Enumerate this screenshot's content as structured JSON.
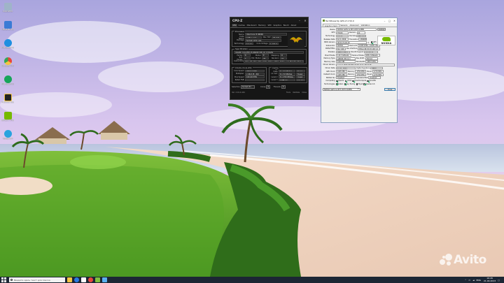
{
  "desktop": {
    "icons": [
      {
        "label": "Корзина",
        "color": "#9fb4c8"
      },
      {
        "label": "Панель управления",
        "color": "#3a7bd5"
      },
      {
        "label": "Microsoft Edge",
        "color": "#1f8fe0"
      },
      {
        "label": "Google Chrome",
        "color": "#e8453c"
      },
      {
        "label": "Microsoft Edge",
        "color": "#17a55a"
      },
      {
        "label": "Process Lasso",
        "color": "#222222"
      },
      {
        "label": "NVIDIA RTX",
        "color": "#76b900"
      },
      {
        "label": "Telegram",
        "color": "#2aa3de"
      }
    ]
  },
  "cpuz": {
    "title": "CPU-Z",
    "tabs": [
      "CPU",
      "Caches",
      "Mainboard",
      "Memory",
      "SPD",
      "Graphics",
      "Bench",
      "About"
    ],
    "active_tab": "CPU",
    "processor_label": "Processor",
    "processor": [
      {
        "key": "Name",
        "value": "Intel Core i5 9600K"
      },
      {
        "key": "Code Name",
        "value": "Coffee Lake",
        "key2": "Max TDP",
        "value2": "95.0 W"
      },
      {
        "key": "Package",
        "value": "Socket 1151 LGA"
      },
      {
        "key": "Technology",
        "value": "14 nm",
        "key2": "Core Voltage",
        "value2": "1.104 V"
      }
    ],
    "spec_label": "Specification",
    "specification": "Intel(R) Core(TM) i5-9600K CPU @ 3.70GHz",
    "family_rows": [
      {
        "a": "Family",
        "av": "6",
        "b": "Model",
        "bv": "E",
        "c": "Stepping",
        "cv": "D"
      },
      {
        "a": "Ext. Family",
        "av": "6",
        "b": "Ext. Model",
        "bv": "9E",
        "c": "Revision",
        "cv": "R0"
      }
    ],
    "instructions_label": "Instructions",
    "instructions": "MMX, SSE, SSE2, SSE3, SSSE3, SSE4.1, SSE4.2, EM64T, VT-x, AES, AVX, AVX2, FMA3",
    "clocks_label": "Clocks (Core #0)",
    "clocks": [
      {
        "key": "Core Speed",
        "value": "4600.0 MHz"
      },
      {
        "key": "Multiplier",
        "value": "x 46.0 (8 - 46)"
      },
      {
        "key": "Bus Speed",
        "value": "100.00 MHz"
      },
      {
        "key": "Rated FSB",
        "value": ""
      }
    ],
    "cache_label": "Cache",
    "cache": [
      {
        "key": "L1 Data",
        "value": "6 x 32 KBytes",
        "way": "8-way"
      },
      {
        "key": "L1 Inst.",
        "value": "6 x 32 KBytes",
        "way": "8-way"
      },
      {
        "key": "Level 2",
        "value": "6 x 256 KBytes",
        "way": "4-way"
      },
      {
        "key": "Level 3",
        "value": "9 MBytes",
        "way": "12-way"
      }
    ],
    "selection_label": "Selection",
    "selection_value": "Socket #1",
    "cores_label": "Cores",
    "cores_value": "6",
    "threads_label": "Threads",
    "threads_value": "6",
    "version": "Ver. 2.01.0.x64",
    "footer_buttons": [
      "Tools",
      "Validate",
      "Close"
    ]
  },
  "gpuz": {
    "title": "TechPowerUp GPU-Z 2.50.0",
    "tabs": [
      "Graphics Card",
      "Sensors",
      "Advanced",
      "Validation"
    ],
    "active_tab": "Graphics Card",
    "rows": [
      {
        "k": "Name",
        "v": "NVIDIA GeForce RTX 2070 SUPER",
        "btn": "Lookup"
      },
      {
        "k": "GPU",
        "v": "TU104",
        "k2": "Revision",
        "v2": "A1"
      },
      {
        "k": "Technology",
        "v": "12 nm",
        "k2": "Die Size",
        "v2": "545 mm²"
      },
      {
        "k": "Release Date",
        "v": "Jul 2, 2019",
        "k2": "Transistors",
        "v2": "13600M"
      },
      {
        "k": "BIOS Version",
        "v": "90.04.7A.40.16"
      },
      {
        "k": "Subvendor",
        "v": "NVIDIA",
        "k2": "Device ID",
        "v2": "10DE 1E84 - 10DE 139F"
      },
      {
        "k": "ROPs/TMUs",
        "v": "64 / 160",
        "k2": "Bus Interface",
        "v2": "PCIe x16 3.0 @ x16 1.1"
      },
      {
        "k": "Shaders",
        "v": "2560 Unified",
        "k2": "DirectX Support",
        "v2": "12 (12_2)"
      },
      {
        "k": "Pixel Fillrate",
        "v": "113.3 GPixel/s",
        "k2": "Texture Fillrate",
        "v2": "283.2 GTexel/s"
      },
      {
        "k": "Memory Type",
        "v": "GDDR6 (Micron)",
        "k2": "Bus Width",
        "v2": "256 bit"
      },
      {
        "k": "Memory Size",
        "v": "8192 MB",
        "k2": "Bandwidth",
        "v2": "448.0 GB/s"
      },
      {
        "k": "Driver Version",
        "v": "31.0.15.1694 (NVIDIA 516.94) DCH / Win10 64"
      },
      {
        "k": "Driver Date",
        "v": "Jul 21, 2022",
        "k2": "Digital Signature",
        "v2": "WHQL"
      },
      {
        "k": "GPU Clock",
        "v": "1605 MHz",
        "k2": "Memory",
        "v2": "1750 MHz",
        "k3": "Boost",
        "v3": "1770 MHz"
      },
      {
        "k": "Default Clock",
        "v": "1605 MHz",
        "k2": "Memory",
        "v2": "1750 MHz",
        "k3": "Boost",
        "v3": "1770 MHz"
      },
      {
        "k": "NVIDIA SLI",
        "v": "Disabled",
        "k2": "Resizable BAR",
        "v2": "Disabled"
      }
    ],
    "computing_label": "Computing",
    "computing": [
      {
        "label": "OpenCL",
        "on": true
      },
      {
        "label": "CUDA",
        "on": true
      },
      {
        "label": "DirectCompute",
        "on": true
      },
      {
        "label": "DirectML",
        "on": true
      }
    ],
    "technologies_label": "Technologies",
    "technologies": [
      {
        "label": "Vulkan",
        "on": true
      },
      {
        "label": "Ray Tracing",
        "on": true
      },
      {
        "label": "PhysX",
        "on": false
      },
      {
        "label": "OpenGL 4.6",
        "on": true
      }
    ],
    "brand": "NVIDIA",
    "brand_color": "#76b900",
    "uefi_label": "UEFI",
    "selected_card": "NVIDIA GeForce RTX 2070 SUPER",
    "close_label": "Close"
  },
  "taskbar": {
    "search_placeholder": "Введите здесь текст для поиска",
    "apps": [
      "#f4c542",
      "#2a7ae2",
      "#ffffff",
      "#e8453c",
      "#7fbf3f",
      "#5ab0f0"
    ],
    "lang": "ENG",
    "time": "16:26",
    "date": "21.04.2023"
  },
  "watermark": "Avito"
}
